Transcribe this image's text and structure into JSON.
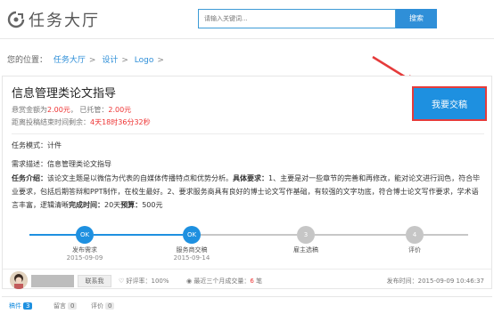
{
  "header": {
    "app_title": "任务大厅",
    "search_placeholder": "请输入关键词...",
    "search_button": "搜索"
  },
  "breadcrumb": {
    "prefix": "您的位置：",
    "items": [
      "任务大厅",
      "设计",
      "Logo"
    ],
    "separator": ">"
  },
  "task": {
    "title": "信息管理类论文指导",
    "reward_label": "悬赏金额为",
    "reward_value": "2.00元",
    "escrow_label": "已托管：",
    "escrow_value": "2.00元",
    "deadline_label": "距离投稿结束时间剩余：",
    "deadline_value": "4天18时36分32秒",
    "submit_button": "我要交稿",
    "mode_label": "任务模式：",
    "mode_value": "计件",
    "req_label": "需求描述：",
    "req_value": "信息管理类论文指导",
    "intro_label": "任务介绍：",
    "intro_text_1": "该论文主题是以微信为代表的自媒体传播特点和优势分析。",
    "intro_req_label": "具体要求：",
    "intro_text_2": "1、主要是对一些章节的完善和再修改，能对论文进行润色，符合毕业要求，包括后期答辩和PPT制作，在校生最好。2、要求服务商具有良好的博士论文写作基础，有较强的文字功底，符合博士论文写作要求，学术语言丰富，逻辑清晰",
    "intro_finish_label": "完成时间：",
    "intro_finish_value": "20天",
    "intro_budget_label": "预算：",
    "intro_budget_value": "500元"
  },
  "steps": [
    {
      "icon": "OK",
      "label": "发布需求",
      "date": "2015-09-09",
      "done": true
    },
    {
      "icon": "OK",
      "label": "服务商交稿",
      "date": "2015-09-14",
      "done": true
    },
    {
      "icon": "3",
      "label": "雇主选稿",
      "date": "",
      "done": false
    },
    {
      "icon": "4",
      "label": "评价",
      "date": "",
      "done": false
    }
  ],
  "publisher": {
    "contact_button": "联系我",
    "rating_label": "好评率：",
    "rating_value": "100%",
    "deals_label": "最近三个月成交量：",
    "deals_value": "6",
    "deals_unit": "笔",
    "publish_label": "发布时间：",
    "publish_value": "2015-09-09 10:46:37"
  },
  "tabs": [
    {
      "label": "稿件",
      "count": "3",
      "active": true
    },
    {
      "label": "留言",
      "count": "0",
      "active": false
    },
    {
      "label": "评价",
      "count": "0",
      "active": false
    }
  ],
  "colors": {
    "accent": "#1e90e0",
    "highlight": "#e53b3b",
    "price": "#e33333"
  }
}
